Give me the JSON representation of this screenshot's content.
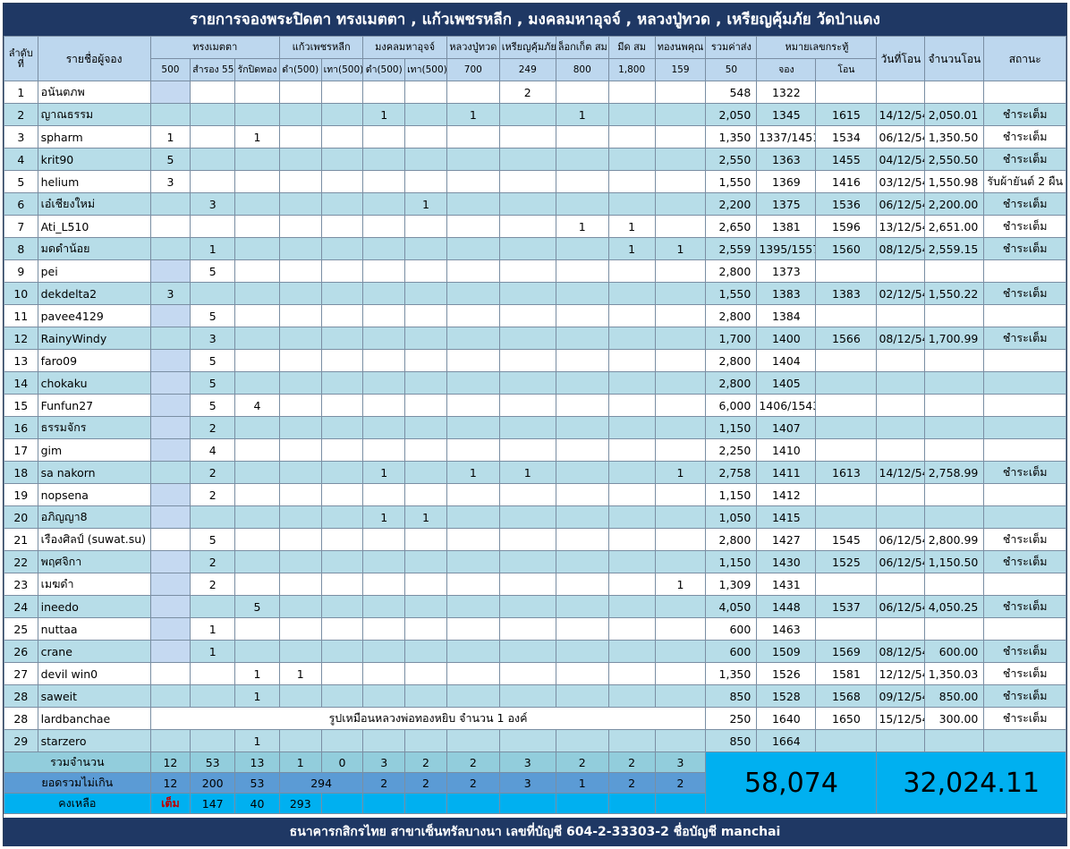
{
  "title": "รายการจองพระปิดตา ทรงเมตตา , แก้วเพชรหลีก , มงคลมหาอุจจ์ , หลวงปู่ทวด , เหรียญคุ้มภัย วัดป่าแดง",
  "footer": "ธนาคารกสิกรไทย สาขาเซ็นทรัลบางนา เลขที่บัญชี 604-2-33303-2 ชื่อบัญชี manchai",
  "header": {
    "no": "ลำดับที่",
    "name": "รายชื่อผู้จอง",
    "song_metta": "ทรงเมตตา",
    "kaew_phet": "แก้วเพชรหลีก",
    "mongkol": "มงคลมหาอุจจ์",
    "lp_thuad": "หลวงปู่ทวด",
    "rian": "เหรียญคุ้มภัย",
    "locket": "ล็อกเก็ต สม",
    "meed": "มีด สม",
    "thong": "ทองนพคุณ",
    "shipping": "รวมค่าส่ง",
    "ticket": "หมายเลขกระทู้",
    "date": "วันที่โอน",
    "amount": "จำนวนโอน",
    "status": "สถานะ",
    "sub_500": "500",
    "sub_550": "สำรอง 550",
    "sub_rak": "รักปิดทอง",
    "sub_dam1": "ดำ(500)",
    "sub_thao1": "เทา(500)",
    "sub_dam2": "ดำ(500)",
    "sub_thao2": "เทา(500)",
    "sub_700": "700",
    "sub_249": "249",
    "sub_800": "800",
    "sub_1800": "1,800",
    "sub_159": "159",
    "sub_50": "50",
    "sub_jong": "จอง",
    "sub_on": "โอน"
  },
  "rows": [
    {
      "no": "1",
      "name": "อนันตภพ",
      "c500": "",
      "c550": "",
      "rak": "",
      "dam1": "",
      "thao1": "",
      "dam2": "",
      "thao2": "",
      "c700": "",
      "c249": "2",
      "c800": "",
      "c1800": "",
      "c159": "",
      "ship": "548",
      "jong": "1322",
      "on": "",
      "date": "",
      "amount": "",
      "status": ""
    },
    {
      "no": "2",
      "name": "ญาณธรรม",
      "c500": "",
      "c550": "",
      "rak": "",
      "dam1": "",
      "thao1": "",
      "dam2": "1",
      "thao2": "",
      "c700": "1",
      "c249": "",
      "c800": "1",
      "c1800": "",
      "c159": "",
      "ship": "2,050",
      "jong": "1345",
      "on": "1615",
      "date": "14/12/54",
      "amount": "2,050.01",
      "status": "ชำระเต็ม"
    },
    {
      "no": "3",
      "name": "spharm",
      "c500": "1",
      "c550": "",
      "rak": "1",
      "dam1": "",
      "thao1": "",
      "dam2": "",
      "thao2": "",
      "c700": "",
      "c249": "",
      "c800": "",
      "c1800": "",
      "c159": "",
      "ship": "1,350",
      "jong": "1337/1451",
      "on": "1534",
      "date": "06/12/54",
      "amount": "1,350.50",
      "status": "ชำระเต็ม"
    },
    {
      "no": "4",
      "name": "krit90",
      "c500": "5",
      "c550": "",
      "rak": "",
      "dam1": "",
      "thao1": "",
      "dam2": "",
      "thao2": "",
      "c700": "",
      "c249": "",
      "c800": "",
      "c1800": "",
      "c159": "",
      "ship": "2,550",
      "jong": "1363",
      "on": "1455",
      "date": "04/12/54",
      "amount": "2,550.50",
      "status": "ชำระเต็ม"
    },
    {
      "no": "5",
      "name": "helium",
      "c500": "3",
      "c550": "",
      "rak": "",
      "dam1": "",
      "thao1": "",
      "dam2": "",
      "thao2": "",
      "c700": "",
      "c249": "",
      "c800": "",
      "c1800": "",
      "c159": "",
      "ship": "1,550",
      "jong": "1369",
      "on": "1416",
      "date": "03/12/54",
      "amount": "1,550.98",
      "status": "รับผ้ายันต์ 2 ผืน"
    },
    {
      "no": "6",
      "name": "เอ๋เชียงใหม่",
      "c500": "",
      "c550": "3",
      "rak": "",
      "dam1": "",
      "thao1": "",
      "dam2": "",
      "thao2": "1",
      "c700": "",
      "c249": "",
      "c800": "",
      "c1800": "",
      "c159": "",
      "ship": "2,200",
      "jong": "1375",
      "on": "1536",
      "date": "06/12/54",
      "amount": "2,200.00",
      "status": "ชำระเต็ม"
    },
    {
      "no": "7",
      "name": "Ati_L510",
      "c500": "",
      "c550": "",
      "rak": "",
      "dam1": "",
      "thao1": "",
      "dam2": "",
      "thao2": "",
      "c700": "",
      "c249": "",
      "c800": "1",
      "c1800": "1",
      "c159": "",
      "ship": "2,650",
      "jong": "1381",
      "on": "1596",
      "date": "13/12/54",
      "amount": "2,651.00",
      "status": "ชำระเต็ม"
    },
    {
      "no": "8",
      "name": "มดดำน้อย",
      "c500": "",
      "c550": "1",
      "rak": "",
      "dam1": "",
      "thao1": "",
      "dam2": "",
      "thao2": "",
      "c700": "",
      "c249": "",
      "c800": "",
      "c1800": "1",
      "c159": "1",
      "ship": "2,559",
      "jong": "1395/1557",
      "on": "1560",
      "date": "08/12/54",
      "amount": "2,559.15",
      "status": "ชำระเต็ม"
    },
    {
      "no": "9",
      "name": "pei",
      "c500": "",
      "c550": "5",
      "rak": "",
      "dam1": "",
      "thao1": "",
      "dam2": "",
      "thao2": "",
      "c700": "",
      "c249": "",
      "c800": "",
      "c1800": "",
      "c159": "",
      "ship": "2,800",
      "jong": "1373",
      "on": "",
      "date": "",
      "amount": "",
      "status": ""
    },
    {
      "no": "10",
      "name": "dekdelta2",
      "c500": "3",
      "c550": "",
      "rak": "",
      "dam1": "",
      "thao1": "",
      "dam2": "",
      "thao2": "",
      "c700": "",
      "c249": "",
      "c800": "",
      "c1800": "",
      "c159": "",
      "ship": "1,550",
      "jong": "1383",
      "on": "1383",
      "date": "02/12/54",
      "amount": "1,550.22",
      "status": "ชำระเต็ม"
    },
    {
      "no": "11",
      "name": "pavee4129",
      "c500": "",
      "c550": "5",
      "rak": "",
      "dam1": "",
      "thao1": "",
      "dam2": "",
      "thao2": "",
      "c700": "",
      "c249": "",
      "c800": "",
      "c1800": "",
      "c159": "",
      "ship": "2,800",
      "jong": "1384",
      "on": "",
      "date": "",
      "amount": "",
      "status": ""
    },
    {
      "no": "12",
      "name": "RainyWindy",
      "c500": "",
      "c550": "3",
      "rak": "",
      "dam1": "",
      "thao1": "",
      "dam2": "",
      "thao2": "",
      "c700": "",
      "c249": "",
      "c800": "",
      "c1800": "",
      "c159": "",
      "ship": "1,700",
      "jong": "1400",
      "on": "1566",
      "date": "08/12/54",
      "amount": "1,700.99",
      "status": "ชำระเต็ม"
    },
    {
      "no": "13",
      "name": "faro09",
      "c500": "",
      "c550": "5",
      "rak": "",
      "dam1": "",
      "thao1": "",
      "dam2": "",
      "thao2": "",
      "c700": "",
      "c249": "",
      "c800": "",
      "c1800": "",
      "c159": "",
      "ship": "2,800",
      "jong": "1404",
      "on": "",
      "date": "",
      "amount": "",
      "status": ""
    },
    {
      "no": "14",
      "name": "chokaku",
      "c500": "",
      "c550": "5",
      "rak": "",
      "dam1": "",
      "thao1": "",
      "dam2": "",
      "thao2": "",
      "c700": "",
      "c249": "",
      "c800": "",
      "c1800": "",
      "c159": "",
      "ship": "2,800",
      "jong": "1405",
      "on": "",
      "date": "",
      "amount": "",
      "status": ""
    },
    {
      "no": "15",
      "name": "Funfun27",
      "c500": "",
      "c550": "5",
      "rak": "4",
      "dam1": "",
      "thao1": "",
      "dam2": "",
      "thao2": "",
      "c700": "",
      "c249": "",
      "c800": "",
      "c1800": "",
      "c159": "",
      "ship": "6,000",
      "jong": "1406/1543",
      "on": "",
      "date": "",
      "amount": "",
      "status": ""
    },
    {
      "no": "16",
      "name": "ธรรมจักร",
      "c500": "",
      "c550": "2",
      "rak": "",
      "dam1": "",
      "thao1": "",
      "dam2": "",
      "thao2": "",
      "c700": "",
      "c249": "",
      "c800": "",
      "c1800": "",
      "c159": "",
      "ship": "1,150",
      "jong": "1407",
      "on": "",
      "date": "",
      "amount": "",
      "status": ""
    },
    {
      "no": "17",
      "name": "gim",
      "c500": "",
      "c550": "4",
      "rak": "",
      "dam1": "",
      "thao1": "",
      "dam2": "",
      "thao2": "",
      "c700": "",
      "c249": "",
      "c800": "",
      "c1800": "",
      "c159": "",
      "ship": "2,250",
      "jong": "1410",
      "on": "",
      "date": "",
      "amount": "",
      "status": ""
    },
    {
      "no": "18",
      "name": "sa nakorn",
      "c500": "",
      "c550": "2",
      "rak": "",
      "dam1": "",
      "thao1": "",
      "dam2": "1",
      "thao2": "",
      "c700": "1",
      "c249": "1",
      "c800": "",
      "c1800": "",
      "c159": "1",
      "ship": "2,758",
      "jong": "1411",
      "on": "1613",
      "date": "14/12/54",
      "amount": "2,758.99",
      "status": "ชำระเต็ม"
    },
    {
      "no": "19",
      "name": "nopsena",
      "c500": "",
      "c550": "2",
      "rak": "",
      "dam1": "",
      "thao1": "",
      "dam2": "",
      "thao2": "",
      "c700": "",
      "c249": "",
      "c800": "",
      "c1800": "",
      "c159": "",
      "ship": "1,150",
      "jong": "1412",
      "on": "",
      "date": "",
      "amount": "",
      "status": ""
    },
    {
      "no": "20",
      "name": "อภิญญา8",
      "c500": "",
      "c550": "",
      "rak": "",
      "dam1": "",
      "thao1": "",
      "dam2": "1",
      "thao2": "1",
      "c700": "",
      "c249": "",
      "c800": "",
      "c1800": "",
      "c159": "",
      "ship": "1,050",
      "jong": "1415",
      "on": "",
      "date": "",
      "amount": "",
      "status": ""
    },
    {
      "no": "21",
      "name": "เรืองศิลป์ (suwat.su)",
      "c500": "",
      "c550": "5",
      "rak": "",
      "dam1": "",
      "thao1": "",
      "dam2": "",
      "thao2": "",
      "c700": "",
      "c249": "",
      "c800": "",
      "c1800": "",
      "c159": "",
      "ship": "2,800",
      "jong": "1427",
      "on": "1545",
      "date": "06/12/54",
      "amount": "2,800.99",
      "status": "ชำระเต็ม"
    },
    {
      "no": "22",
      "name": "พฤศจิกา",
      "c500": "",
      "c550": "2",
      "rak": "",
      "dam1": "",
      "thao1": "",
      "dam2": "",
      "thao2": "",
      "c700": "",
      "c249": "",
      "c800": "",
      "c1800": "",
      "c159": "",
      "ship": "1,150",
      "jong": "1430",
      "on": "1525",
      "date": "06/12/54",
      "amount": "1,150.50",
      "status": "ชำระเต็ม"
    },
    {
      "no": "23",
      "name": "เมฆดำ",
      "c500": "",
      "c550": "2",
      "rak": "",
      "dam1": "",
      "thao1": "",
      "dam2": "",
      "thao2": "",
      "c700": "",
      "c249": "",
      "c800": "",
      "c1800": "",
      "c159": "1",
      "ship": "1,309",
      "jong": "1431",
      "on": "",
      "date": "",
      "amount": "",
      "status": ""
    },
    {
      "no": "24",
      "name": "ineedo",
      "c500": "",
      "c550": "",
      "rak": "5",
      "dam1": "",
      "thao1": "",
      "dam2": "",
      "thao2": "",
      "c700": "",
      "c249": "",
      "c800": "",
      "c1800": "",
      "c159": "",
      "ship": "4,050",
      "jong": "1448",
      "on": "1537",
      "date": "06/12/54",
      "amount": "4,050.25",
      "status": "ชำระเต็ม"
    },
    {
      "no": "25",
      "name": "nuttaa",
      "c500": "",
      "c550": "1",
      "rak": "",
      "dam1": "",
      "thao1": "",
      "dam2": "",
      "thao2": "",
      "c700": "",
      "c249": "",
      "c800": "",
      "c1800": "",
      "c159": "",
      "ship": "600",
      "jong": "1463",
      "on": "",
      "date": "",
      "amount": "",
      "status": ""
    },
    {
      "no": "26",
      "name": "crane",
      "c500": "",
      "c550": "1",
      "rak": "",
      "dam1": "",
      "thao1": "",
      "dam2": "",
      "thao2": "",
      "c700": "",
      "c249": "",
      "c800": "",
      "c1800": "",
      "c159": "",
      "ship": "600",
      "jong": "1509",
      "on": "1569",
      "date": "08/12/54",
      "amount": "600.00",
      "status": "ชำระเต็ม"
    },
    {
      "no": "27",
      "name": "devil win0",
      "c500": "",
      "c550": "",
      "rak": "1",
      "dam1": "1",
      "thao1": "",
      "dam2": "",
      "thao2": "",
      "c700": "",
      "c249": "",
      "c800": "",
      "c1800": "",
      "c159": "",
      "ship": "1,350",
      "jong": "1526",
      "on": "1581",
      "date": "12/12/54",
      "amount": "1,350.03",
      "status": "ชำระเต็ม"
    },
    {
      "no": "28",
      "name": "saweit",
      "c500": "",
      "c550": "",
      "rak": "1",
      "dam1": "",
      "thao1": "",
      "dam2": "",
      "thao2": "",
      "c700": "",
      "c249": "",
      "c800": "",
      "c1800": "",
      "c159": "",
      "ship": "850",
      "jong": "1528",
      "on": "1568",
      "date": "09/12/54",
      "amount": "850.00",
      "status": "ชำระเต็ม"
    },
    {
      "no": "28",
      "name": "lardbanchae",
      "merged": "รูปเหมือนหลวงพ่อทองหยิบ จำนวน 1 องค์",
      "ship": "250",
      "jong": "1640",
      "on": "1650",
      "date": "15/12/54",
      "amount": "300.00",
      "status": "ชำระเต็ม"
    },
    {
      "no": "29",
      "name": "starzero",
      "c500": "",
      "c550": "",
      "rak": "1",
      "dam1": "",
      "thao1": "",
      "dam2": "",
      "thao2": "",
      "c700": "",
      "c249": "",
      "c800": "",
      "c1800": "",
      "c159": "",
      "ship": "850",
      "jong": "1664",
      "on": "",
      "date": "",
      "amount": "",
      "status": ""
    }
  ],
  "blue_cells": [
    0,
    8,
    10,
    12,
    13,
    14,
    15,
    16,
    18,
    19,
    21,
    22,
    23,
    24,
    25
  ],
  "totals": {
    "count_label": "รวมจำนวน",
    "count": [
      "12",
      "53",
      "13",
      "1",
      "0",
      "3",
      "2",
      "2",
      "3",
      "2",
      "2",
      "3"
    ],
    "limit_label": "ยอดรวมไม่เกิน",
    "limit": [
      "12",
      "200",
      "53",
      "294",
      "2",
      "2",
      "2",
      "3",
      "1",
      "2",
      "2"
    ],
    "remain_label": "คงเหลือ",
    "remain": [
      "เต็ม",
      "147",
      "40",
      "293"
    ],
    "grand_shipping": "58,074",
    "grand_amount": "32,024.11"
  },
  "colors": {
    "title_bg": "#1f3864",
    "alt_row": "#b7dde8",
    "header_bg": "#bdd7ee",
    "highlight": "#00b0f0",
    "full_red": "#c00000"
  }
}
